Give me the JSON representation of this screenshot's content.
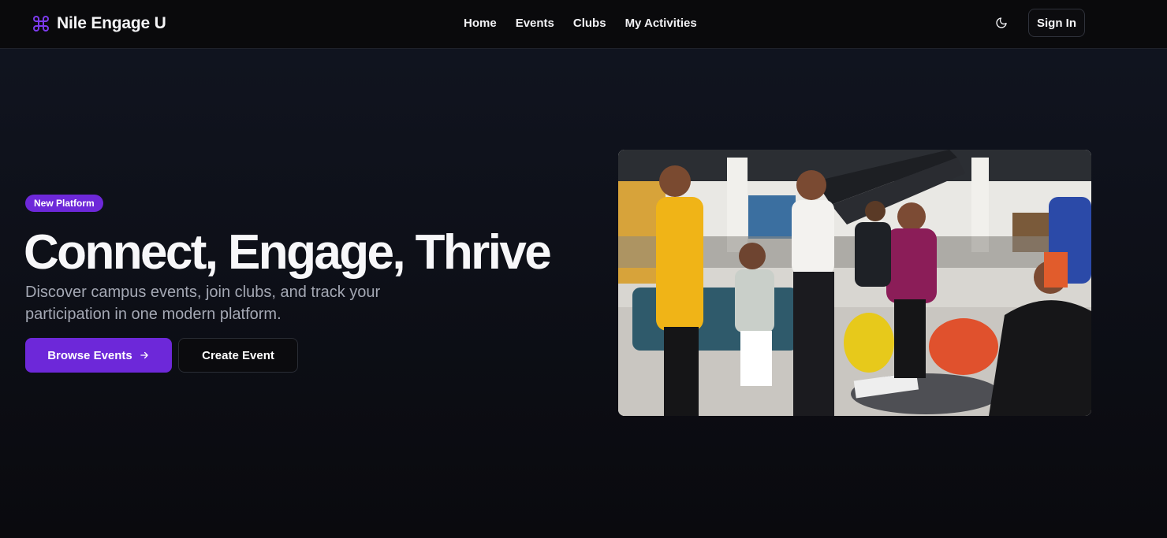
{
  "brand": {
    "name": "Nile Engage U",
    "icon": "command-icon",
    "icon_color": "#7c3aed"
  },
  "nav": {
    "links": [
      {
        "label": "Home"
      },
      {
        "label": "Events"
      },
      {
        "label": "Clubs"
      },
      {
        "label": "My Activities"
      }
    ],
    "theme_toggle_icon": "moon-icon",
    "sign_in_label": "Sign In"
  },
  "hero": {
    "badge": "New Platform",
    "title": "Connect, Engage, Thrive",
    "subtitle": "Discover campus events, join clubs, and track your participation in one modern platform.",
    "primary_button": {
      "label": "Browse Events",
      "icon": "arrow-right-icon"
    },
    "secondary_button": {
      "label": "Create Event"
    },
    "image_subject": "students-gathering-photo"
  },
  "colors": {
    "accent": "#6d28d9",
    "background": "#0d0f17",
    "text": "#f5f5f7",
    "muted_text": "#a4a8b4"
  }
}
